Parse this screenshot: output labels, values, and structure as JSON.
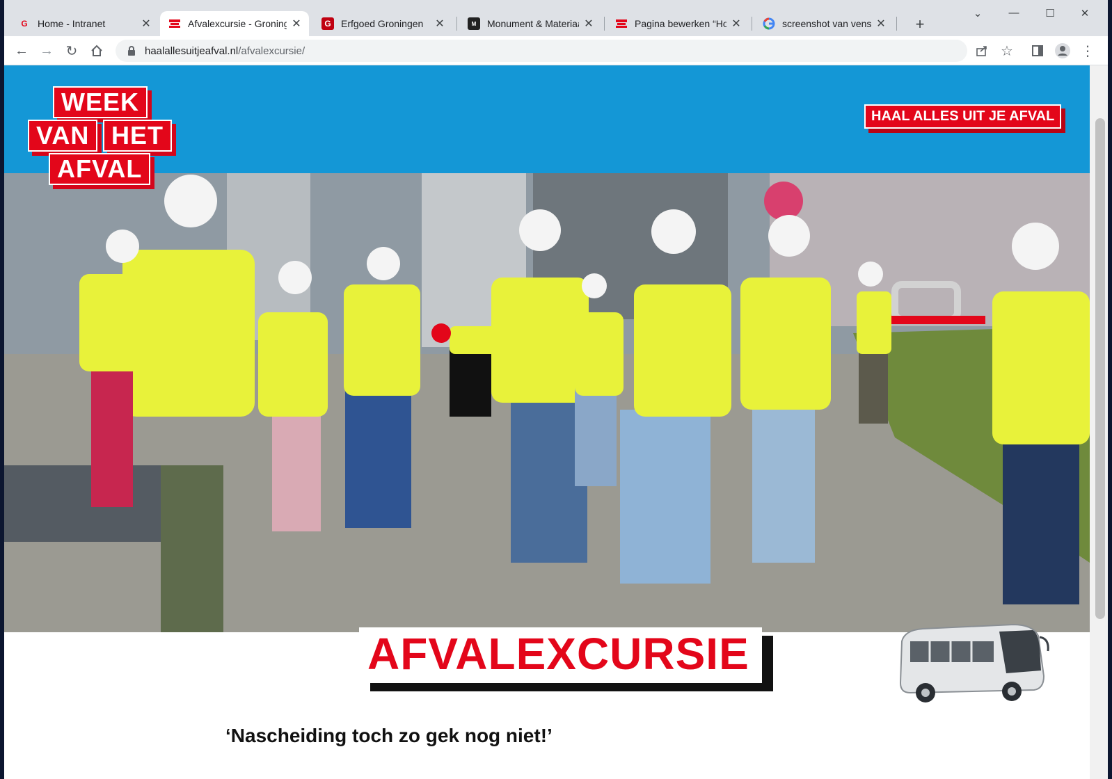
{
  "tabs": [
    {
      "title": "Home - Intranet",
      "icon": "intranet-favicon",
      "active": false
    },
    {
      "title": "Afvalexcursie - Groninge",
      "icon": "week-van-het-afval-favicon",
      "active": true
    },
    {
      "title": "Erfgoed Groningen",
      "icon": "erfgoed-groningen-favicon",
      "active": false
    },
    {
      "title": "Monument & Materiaal",
      "icon": "monument-materiaal-favicon",
      "active": false
    },
    {
      "title": "Pagina bewerken “Hom",
      "icon": "week-van-het-afval-favicon",
      "active": false
    },
    {
      "title": "screenshot van venster",
      "icon": "google-favicon",
      "active": false
    }
  ],
  "toolbar": {
    "url_host": "haalallesuitjeafval.nl",
    "url_path": "/afvalexcursie/"
  },
  "site": {
    "logo_lines": [
      "WEEK",
      "VAN",
      "HET",
      "AFVAL"
    ],
    "cta_label": "HAAL ALLES UIT JE AFVAL"
  },
  "main": {
    "headline": "AFVALEXCURSIE",
    "quote": "‘Nascheiding toch zo gek nog niet!’"
  },
  "colors": {
    "brand_red": "#e3061a",
    "header_blue": "#1497d6",
    "vest_yellow": "#e8f23a"
  }
}
